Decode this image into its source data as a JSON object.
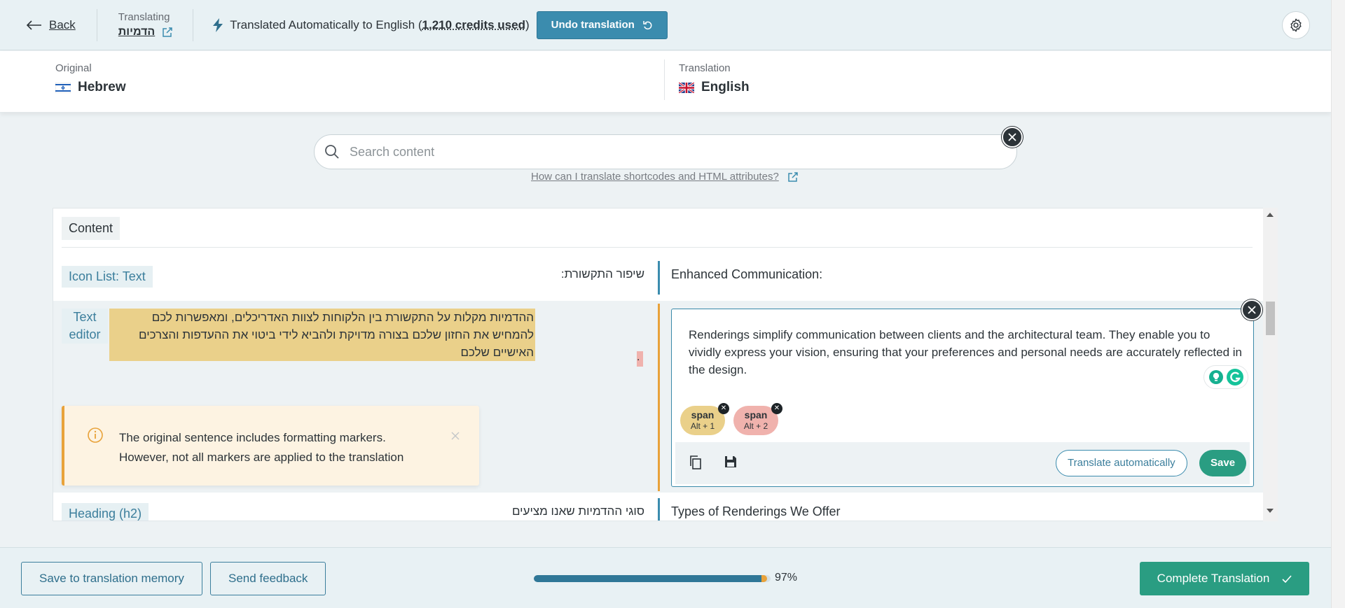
{
  "topbar": {
    "back_label": "Back",
    "translating_label": "Translating",
    "post_title": "הדמיות",
    "auto_prefix": "Translated Automatically to English (",
    "credits": "1,210 credits used",
    "auto_suffix": ")",
    "undo_label": "Undo translation"
  },
  "languages": {
    "original_label": "Original",
    "original_name": "Hebrew",
    "translation_label": "Translation",
    "translation_name": "English"
  },
  "search": {
    "placeholder": "Search content",
    "help_link": "How can I translate shortcodes and HTML attributes?"
  },
  "content": {
    "section_label": "Content",
    "rows": [
      {
        "type": "Icon List: Text",
        "source": "שיפור התקשורת:",
        "translation": "Enhanced Communication:"
      },
      {
        "type_line1": "Text",
        "type_line2": "editor",
        "source": "ההדמיות מקלות על התקשורת בין הלקוחות לצוות האדריכלים, ומאפשרות לכם להמחיש את החזון שלכם בצורה מדויקת ולהביא לידי ביטוי את ההעדפות והצרכים האישיים שלכם",
        "source_trailing": ".",
        "translation": "Renderings simplify communication between clients and the architectural team. They enable you to vividly express your vision, ensuring that your preferences and personal needs are accurately reflected in the design.",
        "warning_line1": "The original sentence includes formatting markers.",
        "warning_line2": "However, not all markers are applied to the translation",
        "markers": [
          {
            "tag": "span",
            "shortcut": "Alt + 1",
            "color": "#ead08a"
          },
          {
            "tag": "span",
            "shortcut": "Alt + 2",
            "color": "#f0b2ad"
          }
        ],
        "translate_auto_label": "Translate automatically",
        "save_label": "Save"
      },
      {
        "type": "Heading (h2)",
        "source": "סוגי ההדמיות שאנו מציעים",
        "translation": "Types of Renderings We Offer"
      }
    ]
  },
  "bottombar": {
    "save_memory_label": "Save to translation memory",
    "feedback_label": "Send feedback",
    "progress_percent": 97,
    "progress_text": "97%",
    "complete_label": "Complete Translation"
  },
  "colors": {
    "accent": "#3b8cae",
    "success": "#2a9d82",
    "highlight": "#ead08a",
    "warning": "#e8a23a"
  }
}
